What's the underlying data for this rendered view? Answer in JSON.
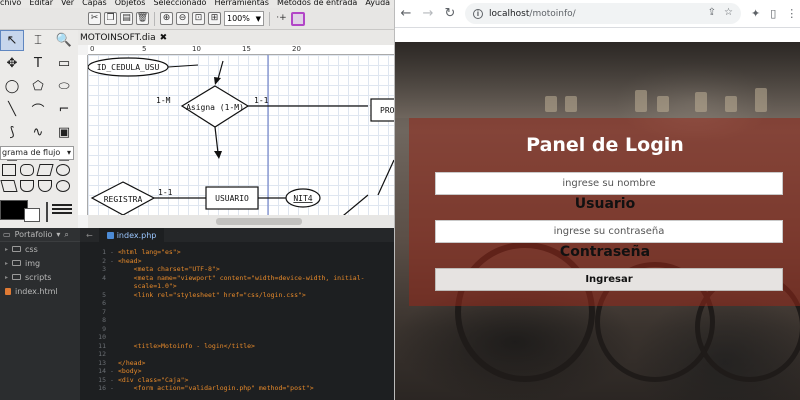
{
  "dia": {
    "menu": [
      "chivo",
      "Editar",
      "Ver",
      "Capas",
      "Objetos",
      "Seleccionado",
      "Herramientas",
      "Métodos de entrada",
      "Ayuda"
    ],
    "zoom": "100%",
    "sheet": "grama de flujo",
    "diagram_tab": "MOTOINSOFT.dia",
    "ruler": [
      "0",
      "5",
      "10",
      "15",
      "20"
    ],
    "er": {
      "attr_cedula": "ID_CEDULA_USU",
      "rel_asigna": "Asigna (1-M)",
      "card_left": "1-M",
      "card_right": "1-1",
      "rel_registra": "REGISTRA",
      "card_reg": "1-1",
      "entity_usuario": "USUARIO",
      "attr_nit": "NIT4",
      "entity_pro": "PRO"
    }
  },
  "editor": {
    "project": "Portafolio",
    "tree": [
      {
        "name": "css",
        "kind": "folder"
      },
      {
        "name": "img",
        "kind": "folder"
      },
      {
        "name": "scripts",
        "kind": "folder"
      },
      {
        "name": "index.html",
        "kind": "file"
      }
    ],
    "back_arrow": "←",
    "active_tab": "index.php",
    "lines": [
      {
        "n": "1",
        "fold": "-",
        "text": "<html lang=\"es\">"
      },
      {
        "n": "2",
        "fold": "-",
        "text": "<head>"
      },
      {
        "n": "3",
        "fold": "",
        "text": "    <meta charset=\"UTF-8\">"
      },
      {
        "n": "4",
        "fold": "",
        "text": "    <meta name=\"viewport\" content=\"width=device-width, initial-"
      },
      {
        "n": "",
        "fold": "",
        "text": "    scale=1.0\">"
      },
      {
        "n": "5",
        "fold": "",
        "text": "    <link rel=\"stylesheet\" href=\"css/login.css\">"
      },
      {
        "n": "6",
        "fold": "",
        "text": ""
      },
      {
        "n": "7",
        "fold": "",
        "text": ""
      },
      {
        "n": "8",
        "fold": "",
        "text": ""
      },
      {
        "n": "9",
        "fold": "",
        "text": ""
      },
      {
        "n": "10",
        "fold": "",
        "text": ""
      },
      {
        "n": "11",
        "fold": "",
        "text": "    <title>Motoinfo - login</title>"
      },
      {
        "n": "12",
        "fold": "",
        "text": ""
      },
      {
        "n": "13",
        "fold": "",
        "text": "</head>"
      },
      {
        "n": "14",
        "fold": "-",
        "text": "<body>"
      },
      {
        "n": "15",
        "fold": "-",
        "text": "<div class=\"Caja\">"
      },
      {
        "n": "16",
        "fold": "-",
        "text": "    <form action=\"validarlogin.php\" method=\"post\">"
      }
    ]
  },
  "browser": {
    "url_host": "localhost",
    "url_path": "/motoinfo/",
    "panel_title": "Panel de Login",
    "user_placeholder": "ingrese su nombre",
    "user_label": "Usuario",
    "pass_placeholder": "ingrese su contraseña",
    "pass_label": "Contraseña",
    "submit_label": "Ingresar"
  },
  "colors": {
    "panel_overlay": "#962819",
    "editor_bg": "#1d1f21",
    "code_orange": "#e88a2a"
  }
}
